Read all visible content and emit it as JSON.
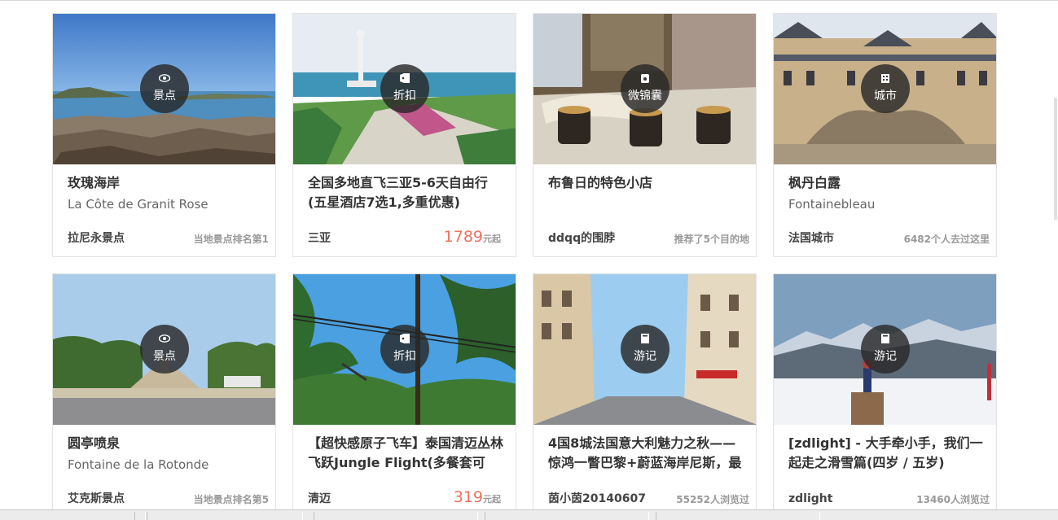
{
  "cards": [
    {
      "badge": {
        "icon": "eye-icon",
        "label": "景点"
      },
      "title": "玫瑰海岸",
      "subtitle": "La Côte de Granit Rose",
      "location": "拉尼永景点",
      "meta": "当地景点排名第1"
    },
    {
      "badge": {
        "icon": "tag-icon",
        "label": "折扣"
      },
      "title": "全国多地直飞三亚5-6天自由行(五星酒店7选1,多重优惠)",
      "location": "三亚",
      "price": {
        "value": "1789",
        "unit": "元起"
      }
    },
    {
      "badge": {
        "icon": "bag-icon",
        "label": "微锦囊"
      },
      "title": "布鲁日的特色小店",
      "location": "ddqq的围脖",
      "meta": "推荐了5个目的地"
    },
    {
      "badge": {
        "icon": "building-icon",
        "label": "城市"
      },
      "title": "枫丹白露",
      "subtitle": "Fontainebleau",
      "location": "法国城市",
      "meta": "6482个人去过这里"
    },
    {
      "badge": {
        "icon": "eye-icon",
        "label": "景点"
      },
      "title": "圆亭喷泉",
      "subtitle": "Fontaine de la Rotonde",
      "location": "艾克斯景点",
      "meta": "当地景点排名第5"
    },
    {
      "badge": {
        "icon": "tag-icon",
        "label": "折扣"
      },
      "title": "【超快感原子飞车】泰国清迈丛林飞跃Jungle Flight(多餐套可",
      "location": "清迈",
      "price": {
        "value": "319",
        "unit": "元起"
      }
    },
    {
      "badge": {
        "icon": "book-icon",
        "label": "游记"
      },
      "title": "4国8城法国意大利魅力之秋——惊鸿一瞥巴黎+蔚蓝海岸尼斯，最",
      "location": "茵小茵20140607",
      "meta": "55252人浏览过"
    },
    {
      "badge": {
        "icon": "book-icon",
        "label": "游记"
      },
      "title": "[zdlight] - 大手牵小手，我们一起走之滑雪篇(四岁 / 五岁)",
      "location": "zdlight",
      "meta": "13460人浏览过"
    }
  ]
}
